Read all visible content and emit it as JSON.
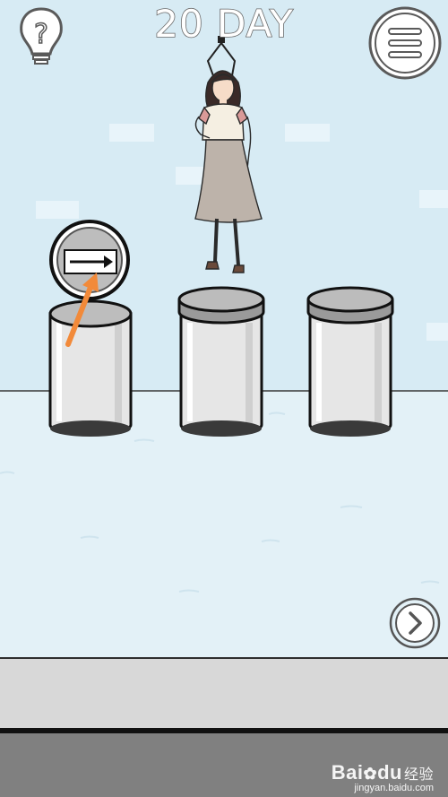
{
  "game": {
    "day_label": "20 DAY"
  },
  "buttons": {
    "hint_icon": "lightbulb-question-icon",
    "menu_icon": "hamburger-menu-icon",
    "next_icon": "chevron-right-icon"
  },
  "scene": {
    "lid_symbol": "right-arrow",
    "trash_cans": [
      "left-can-open",
      "middle-can",
      "right-can"
    ],
    "character": "hanging-woman"
  },
  "watermark": {
    "logo": "Bai",
    "logo_suffix": "du",
    "logo_cn": "经验",
    "url": "jingyan.baidu.com"
  },
  "colors": {
    "sky": "#d7ebf4",
    "floor": "#e3f1f7",
    "bottom_bar": "#808080",
    "arrow_overlay": "#f28a3a"
  }
}
